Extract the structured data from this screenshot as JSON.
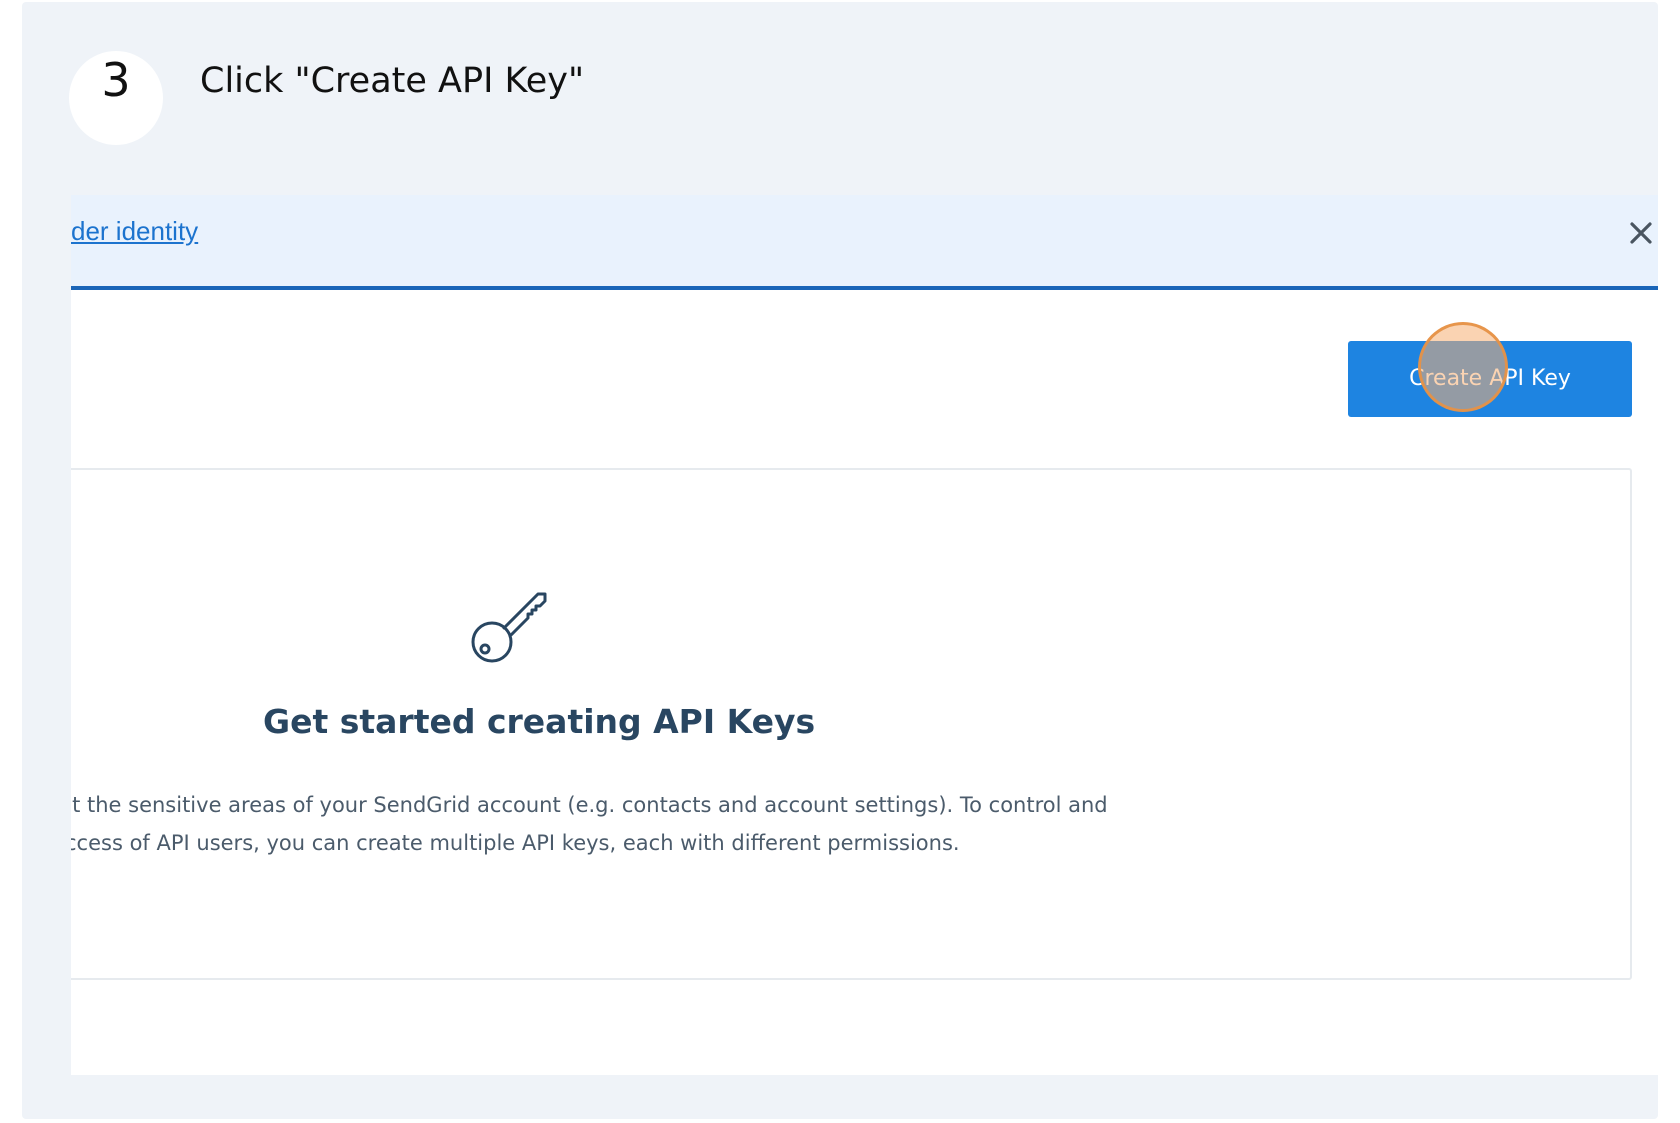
{
  "step": {
    "number": "3",
    "title": "Click \"Create API Key\""
  },
  "banner": {
    "link_text": "der identity",
    "close_icon": "close-icon"
  },
  "toolbar": {
    "create_label": "Create API Key"
  },
  "empty_state": {
    "icon": "key-icon",
    "title": "Get started creating API Keys",
    "description_line1": ":t the sensitive areas of your SendGrid account (e.g. contacts and account settings). To control and",
    "description_line2": "ccess of API users, you can create multiple API keys, each with different permissions."
  },
  "colors": {
    "background": "#eff3f8",
    "banner_bg": "#e9f2fd",
    "banner_border": "#1a65b8",
    "link": "#1c73ce",
    "primary_button": "#1e84e1",
    "heading": "#294661",
    "body_text": "#4b5b6b",
    "click_marker": "#f5af73"
  }
}
